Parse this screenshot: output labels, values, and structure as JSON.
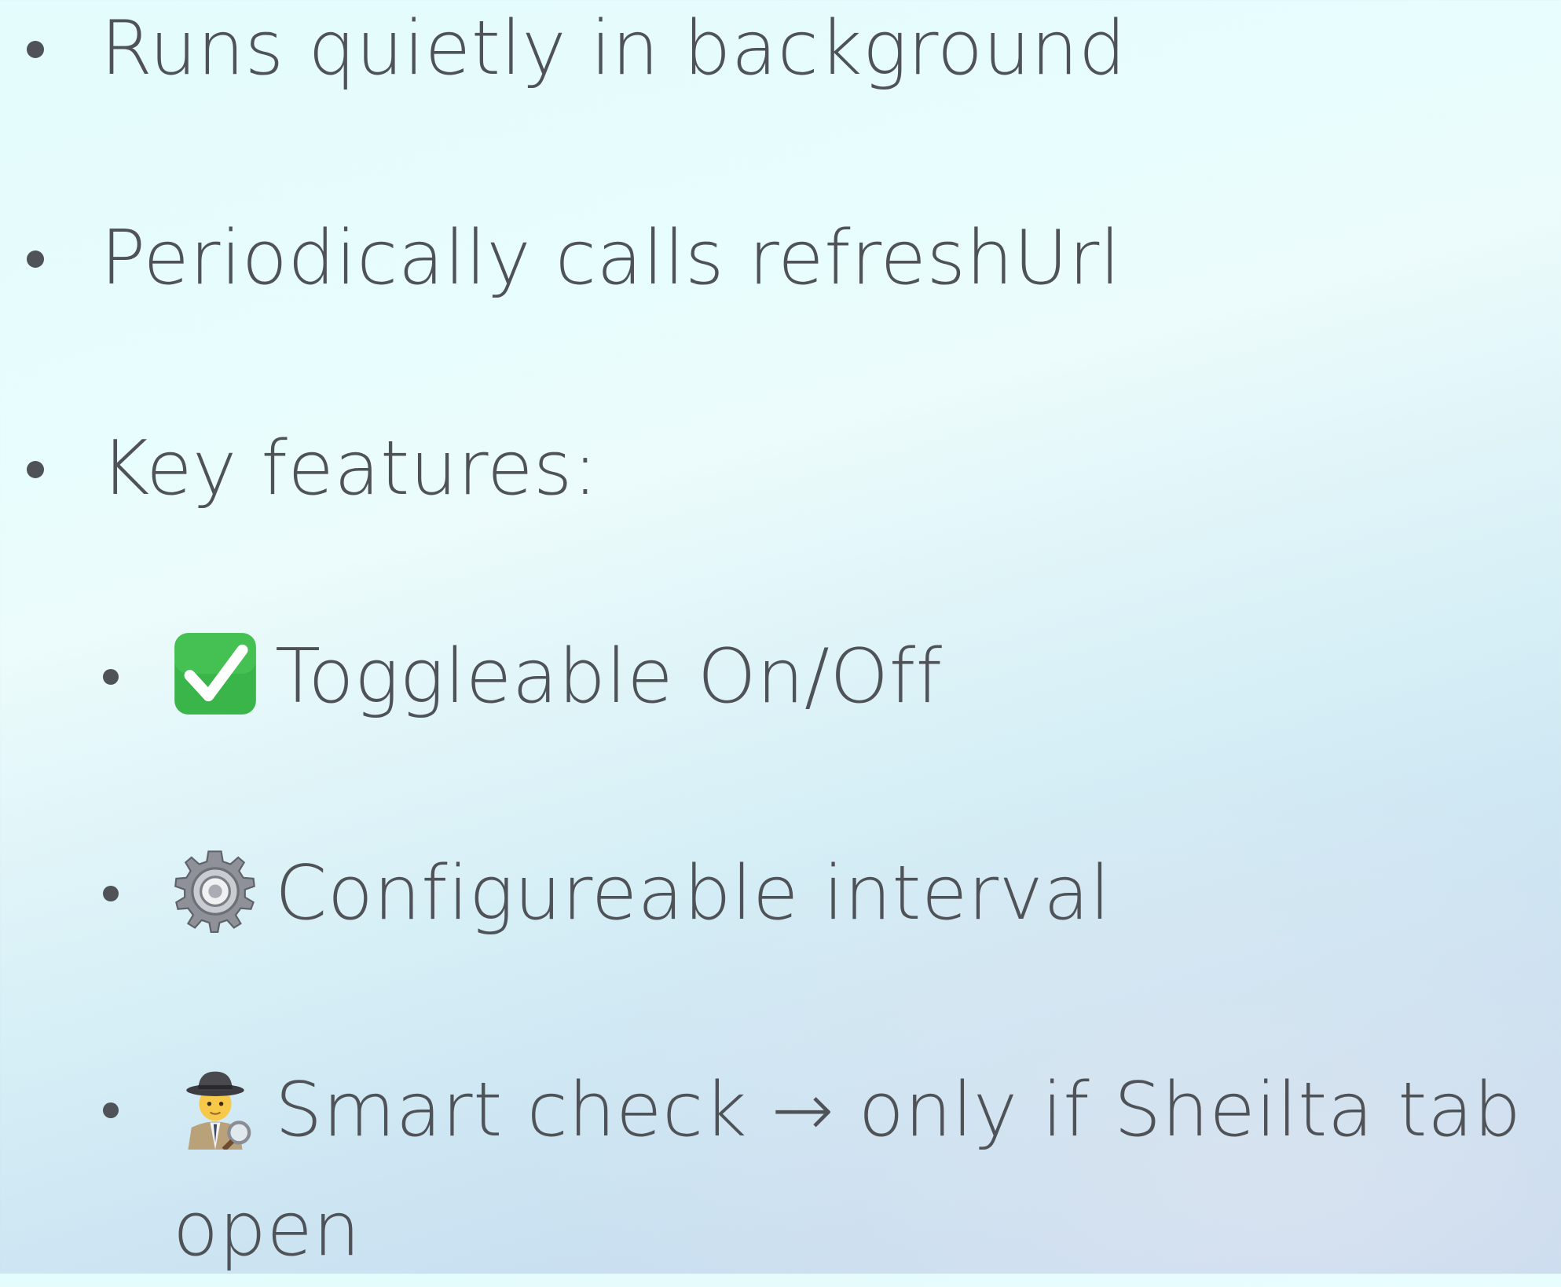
{
  "bullets": [
    {
      "text": "Runs quietly in background"
    },
    {
      "text": "Periodically calls refreshUrl"
    },
    {
      "text": "Key features:"
    }
  ],
  "features": [
    {
      "icon": "check-mark-button-icon",
      "text": "Toggleable On/Off"
    },
    {
      "icon": "gear-icon",
      "text": "Configureable interval"
    },
    {
      "icon": "detective-icon",
      "text": "Smart check → only if Sheilta tab",
      "continuation": "open"
    }
  ],
  "colors": {
    "text": "#4f5257",
    "check_green": "#3ab54a"
  }
}
